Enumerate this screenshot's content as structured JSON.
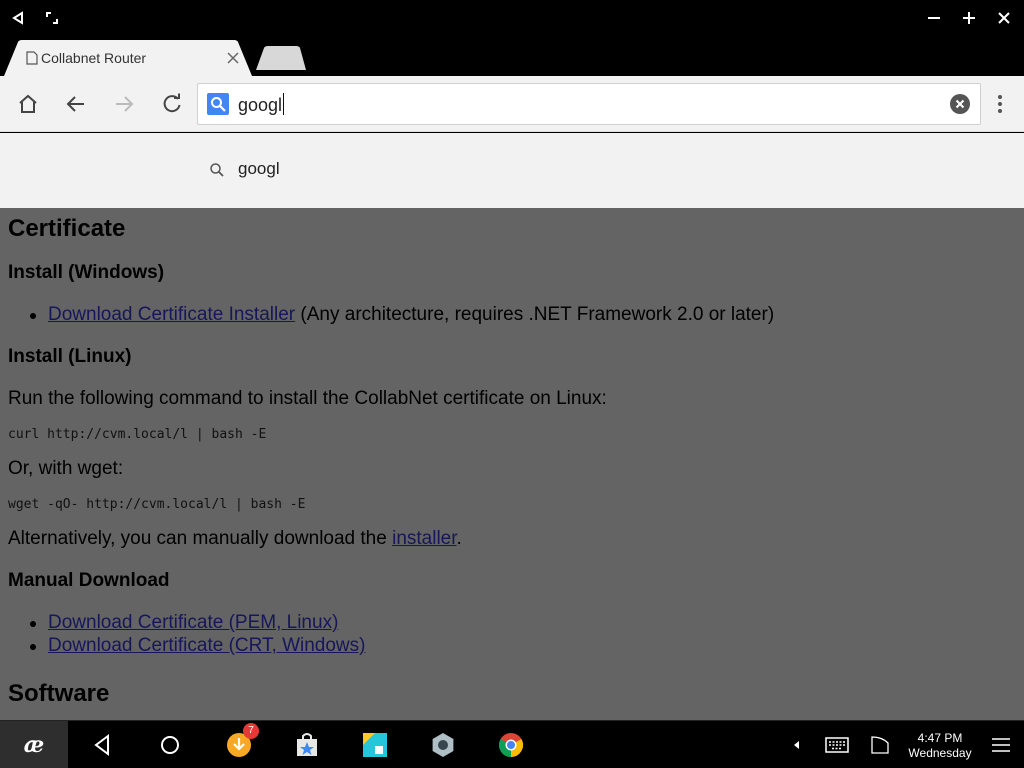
{
  "tabs": [
    {
      "title": "Collabnet Router",
      "active": true
    }
  ],
  "omnibox": {
    "value": "googl"
  },
  "suggestions": [
    {
      "text": "googl",
      "icon": "search-icon"
    }
  ],
  "page": {
    "title": "Certificate",
    "install_windows": {
      "heading": "Install (Windows)",
      "link": "Download Certificate Installer",
      "note": "(Any architecture, requires .NET Framework 2.0 or later)"
    },
    "install_linux": {
      "heading": "Install (Linux)",
      "intro": "Run the following command to install the CollabNet certificate on Linux:",
      "curl_cmd": "curl http://cvm.local/l | bash -E",
      "or_text": "Or, with wget:",
      "wget_cmd": "wget -qO- http://cvm.local/l | bash -E",
      "alt_before": "Alternatively, you can manually download the",
      "alt_link": "installer",
      "alt_after": "."
    },
    "manual": {
      "heading": "Manual Download",
      "links": [
        "Download Certificate (PEM, Linux)",
        "Download Certificate (CRT, Windows)"
      ]
    },
    "software_heading": "Software"
  },
  "taskbar": {
    "start_label": "æ",
    "notification_badge": "7",
    "time": "4:47 PM",
    "day": "Wednesday"
  },
  "colors": {
    "accent": "#4285f4",
    "page_bg": "#646464",
    "link": "#16165a",
    "badge": "#e53935"
  }
}
